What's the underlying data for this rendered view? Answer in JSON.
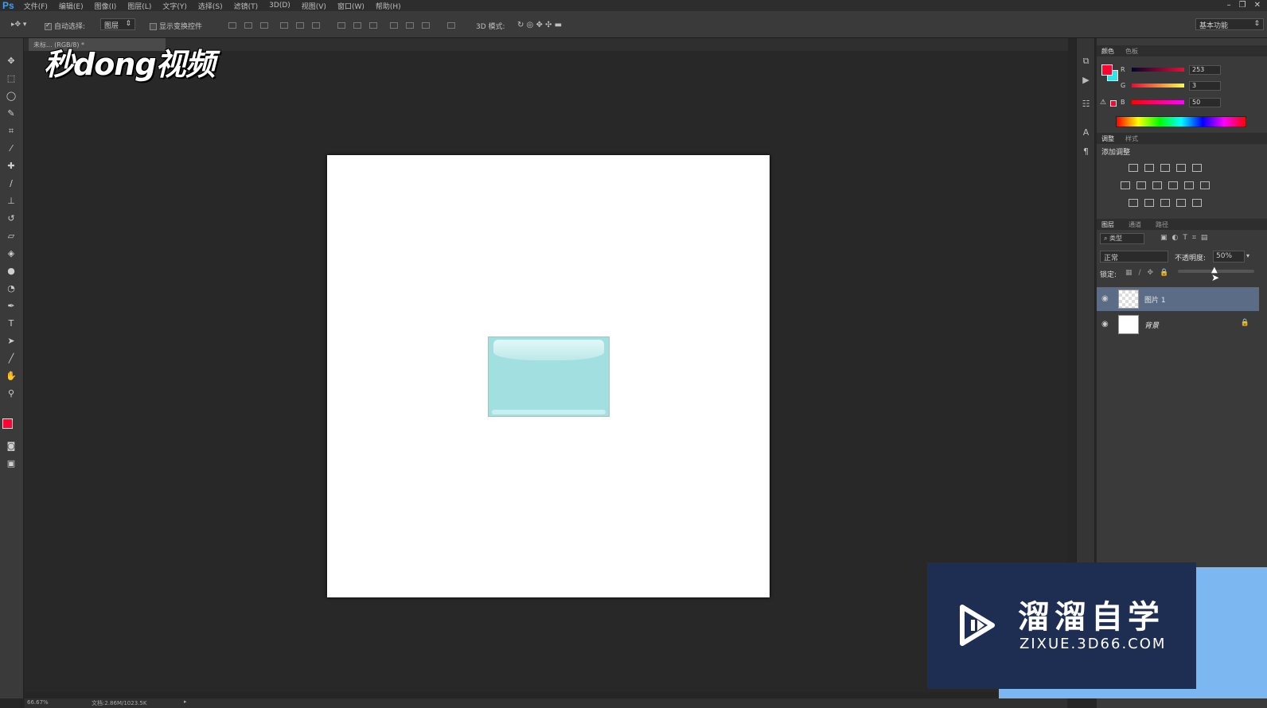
{
  "app": {
    "logo": "Ps"
  },
  "menu": [
    "文件(F)",
    "编辑(E)",
    "图像(I)",
    "图层(L)",
    "文字(Y)",
    "选择(S)",
    "滤镜(T)",
    "3D(D)",
    "视图(V)",
    "窗口(W)",
    "帮助(H)"
  ],
  "options": {
    "auto_select_label": "自动选择:",
    "auto_select_value": "图层",
    "show_transform_label": "显示变换控件",
    "mode_3d_label": "3D 模式:",
    "workspace": "基本功能"
  },
  "document": {
    "tab_label": "未标...   (RGB/8) *",
    "zoom": "66.67%",
    "doc_info": "文档:2.86M/1023.5K"
  },
  "watermark_logo": "秒dong视频",
  "panels": {
    "color": {
      "tabs": [
        "颜色",
        "色板"
      ],
      "r_label": "R",
      "g_label": "G",
      "b_label": "B",
      "r": "253",
      "g": "3",
      "b": "50",
      "fg_color": "#fd0332",
      "bg_color": "#2ee6e6"
    },
    "adjustments": {
      "tabs": [
        "调整",
        "样式"
      ],
      "add_label": "添加调整"
    },
    "layers": {
      "tabs": [
        "图层",
        "通道",
        "路径"
      ],
      "filter": "类型",
      "blend_mode": "正常",
      "opacity_label": "不透明度:",
      "opacity": "50%",
      "lock_label": "锁定:",
      "items": [
        {
          "name": "图片 1",
          "selected": true
        },
        {
          "name": "背景",
          "selected": false
        }
      ]
    }
  },
  "zixue": {
    "title": "溜溜自学",
    "url": "ZIXUE.3D66.COM"
  }
}
